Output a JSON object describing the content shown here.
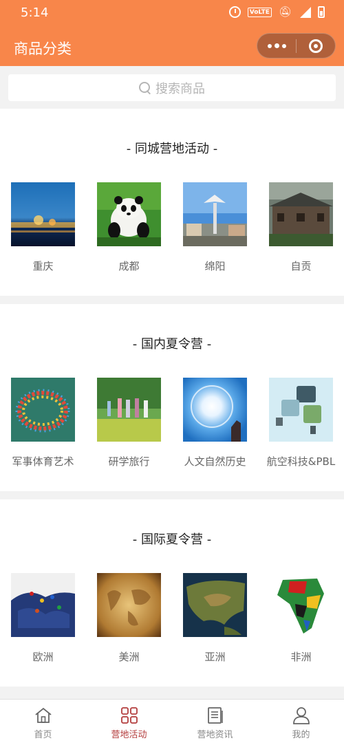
{
  "status_bar": {
    "time": "5:14",
    "network_badge": "VoLTE",
    "network_type": "4G"
  },
  "titlebar": {
    "title": "商品分类"
  },
  "search": {
    "placeholder": "搜索商品"
  },
  "sections": [
    {
      "title": "-  同城营地活动  -",
      "items": [
        {
          "label": "重庆",
          "image": "chongqing-night-skyline"
        },
        {
          "label": "成都",
          "image": "panda"
        },
        {
          "label": "绵阳",
          "image": "mianyang-monument"
        },
        {
          "label": "自贡",
          "image": "zigong-old-buildings"
        }
      ]
    },
    {
      "title": "-  国内夏令营  -",
      "items": [
        {
          "label": "军事体育艺术",
          "image": "kayak-ring"
        },
        {
          "label": "研学旅行",
          "image": "group-in-field"
        },
        {
          "label": "人文自然历史",
          "image": "sun-halo"
        },
        {
          "label": "航空科技&PBL",
          "image": "puzzle-pieces"
        }
      ]
    },
    {
      "title": "-  国际夏令营  -",
      "items": [
        {
          "label": "欧洲",
          "image": "europe-map-flags"
        },
        {
          "label": "美洲",
          "image": "antique-map"
        },
        {
          "label": "亚洲",
          "image": "asia-satellite-map"
        },
        {
          "label": "非洲",
          "image": "africa-flag-map"
        }
      ]
    }
  ],
  "tabbar": {
    "items": [
      {
        "label": "首页",
        "icon": "home-icon",
        "active": false
      },
      {
        "label": "营地活动",
        "icon": "grid-icon",
        "active": true
      },
      {
        "label": "营地资讯",
        "icon": "news-icon",
        "active": false
      },
      {
        "label": "我的",
        "icon": "user-icon",
        "active": false
      }
    ]
  },
  "colors": {
    "header": "#f8864a",
    "active_tab": "#b33c3c",
    "page_bg": "#f2f2f2"
  }
}
